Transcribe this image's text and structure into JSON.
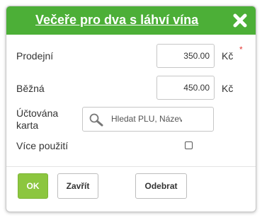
{
  "dialog": {
    "title": "Večeře pro dva s láhví vína"
  },
  "fields": {
    "sale": {
      "label": "Prodejní",
      "value": "350.00",
      "currency": "Kč",
      "required_mark": "*"
    },
    "regular": {
      "label": "Běžná",
      "value": "450.00",
      "currency": "Kč"
    },
    "card": {
      "label_line1": "Účtována",
      "label_line2": "karta",
      "placeholder": "Hledat PLU, Název, EAN"
    },
    "multi_use": {
      "label": "Více použití",
      "checked": false
    }
  },
  "buttons": {
    "ok": "OK",
    "close": "Zavřít",
    "remove": "Odebrat"
  },
  "colors": {
    "header": "#4caf37",
    "ok_button": "#8cc63f",
    "add_icon": "#f5c400",
    "required": "#e53935"
  }
}
